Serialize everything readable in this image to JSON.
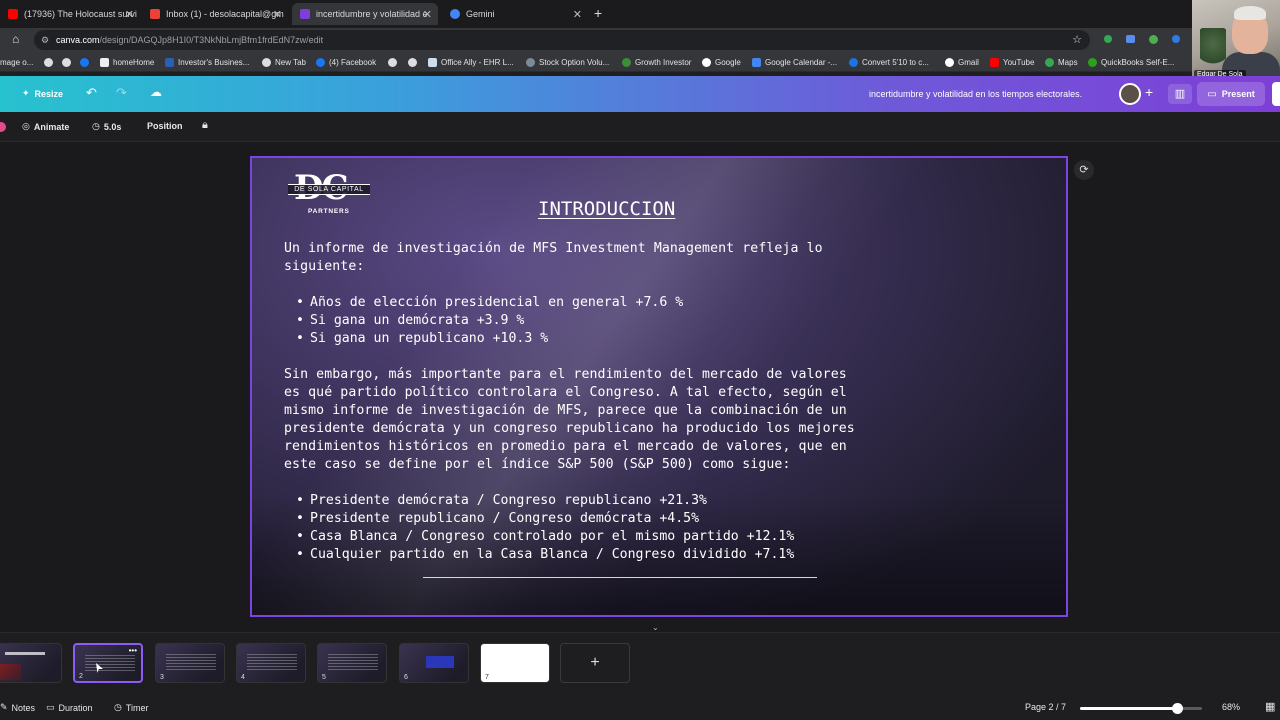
{
  "browser": {
    "tabs": [
      {
        "label": "(17936) The Holocaust survi",
        "color": "#ff0000",
        "active": false
      },
      {
        "label": "Inbox (1) - desolacapital@gm",
        "color": "#ea4335",
        "active": false
      },
      {
        "label": "incertidumbre y volatilidad e",
        "color": "#7d3fd6",
        "active": true
      },
      {
        "label": "Gemini",
        "color": "#4285f4",
        "active": false
      }
    ],
    "url_host": "canva.com",
    "url_path": "/design/DAGQJp8H1I0/T3NkNbLmjBfm1frdEdN7zw/edit",
    "bookmarks": [
      "mage o...",
      "homeHome",
      "Investor's Busines...",
      "New Tab",
      "(4) Facebook",
      "Office Ally - EHR L...",
      "Stock Option Volu...",
      "Growth Investor",
      "Google",
      "Google Calendar -...",
      "Convert 5'10 to c...",
      "Gmail",
      "YouTube",
      "Maps",
      "QuickBooks Self-E..."
    ]
  },
  "webcam": {
    "name": "Edgar De Sola"
  },
  "canva": {
    "resize_label": "Resize",
    "design_title": "incertidumbre y volatilidad en los tiempos electorales.",
    "present_label": "Present",
    "toolbar": {
      "animate": "Animate",
      "duration": "5.0s",
      "position": "Position"
    }
  },
  "slide": {
    "logo": {
      "letters": "DC",
      "band": "DE SOLA CAPITAL",
      "sub": "PARTNERS"
    },
    "title": "INTRODUCCION",
    "intro_line1": "Un informe de investigación de MFS Investment Management refleja lo",
    "intro_line2": "siguiente:",
    "bullets1": [
      "Años de elección presidencial en general +7.6 %",
      "Si gana un demócrata +3.9 %",
      "Si gana un republicano +10.3 %"
    ],
    "para_lines": [
      "Sin embargo, más importante para el rendimiento del mercado de valores",
      "es qué partido político controlara el Congreso. A tal efecto, según el",
      "mismo informe de investigación de MFS, parece que la combinación de un",
      "presidente demócrata y un congreso republicano ha producido los mejores",
      "rendimientos históricos en promedio para el mercado de valores, que en",
      "este caso se define por el índice S&P 500 (S&P 500) como sigue:"
    ],
    "bullets2": [
      "Presidente demócrata / Congreso republicano +21.3%",
      "Presidente republicano / Congreso demócrata +4.5%",
      "Casa Blanca / Congreso controlado por el mismo partido +12.1%",
      "Cualquier partido en la Casa Blanca / Congreso dividido +7.1%"
    ]
  },
  "thumbnails": [
    "",
    "2",
    "3",
    "4",
    "5",
    "6",
    "7"
  ],
  "add_page_label": "+",
  "footer": {
    "notes": "Notes",
    "duration": "Duration",
    "timer": "Timer",
    "page_indicator": "Page 2 / 7",
    "zoom": "68%",
    "zoom_level": 0.68
  }
}
